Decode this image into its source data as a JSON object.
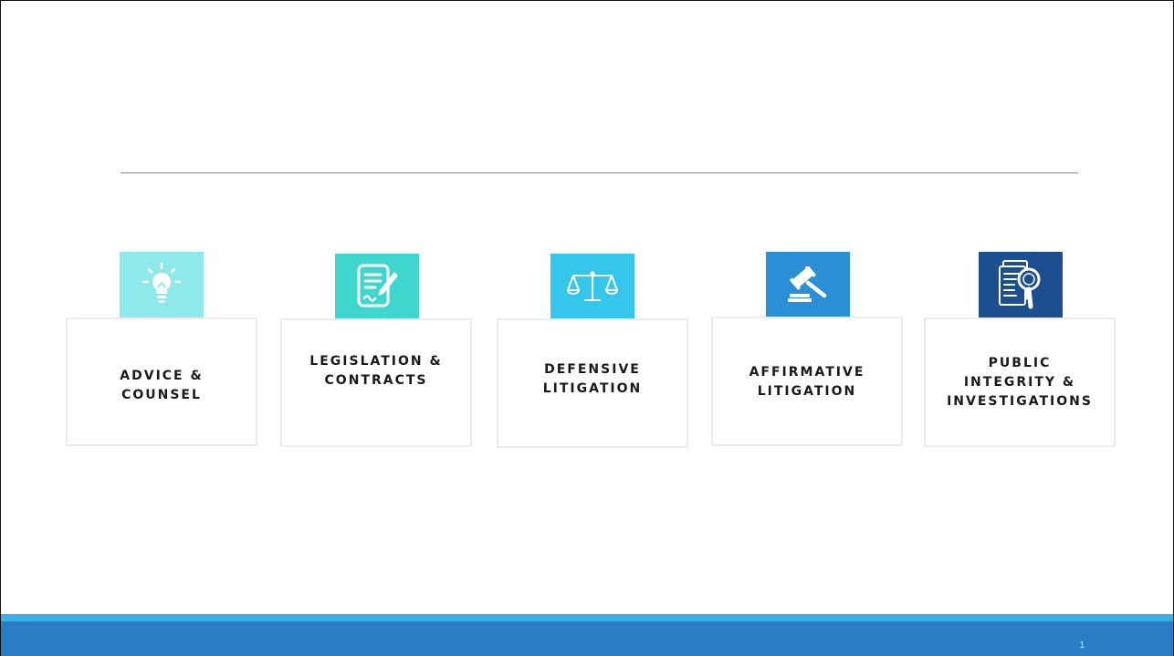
{
  "slide": {
    "cards": [
      {
        "id": "advice",
        "label": "ADVICE &\nCOUNSEL",
        "icon": "lightbulb-icon",
        "icon_color": "#8ee9eb"
      },
      {
        "id": "legislation",
        "label": "LEGISLATION &\nCONTRACTS",
        "icon": "document-pen-icon",
        "icon_color": "#3ed6cd"
      },
      {
        "id": "defensive",
        "label": "DEFENSIVE\nLITIGATION",
        "icon": "scales-icon",
        "icon_color": "#35c6ec"
      },
      {
        "id": "affirmative",
        "label": "AFFIRMATIVE\nLITIGATION",
        "icon": "gavel-icon",
        "icon_color": "#2b8fd5"
      },
      {
        "id": "public",
        "label": "PUBLIC\nINTEGRITY &\nINVESTIGATIONS",
        "icon": "document-magnifier-icon",
        "icon_color": "#1b4f8f"
      }
    ],
    "page_number": "1"
  },
  "theme": {
    "footer_color": "#2a7cc4",
    "footer_stripe_color": "#3cb2e4"
  }
}
